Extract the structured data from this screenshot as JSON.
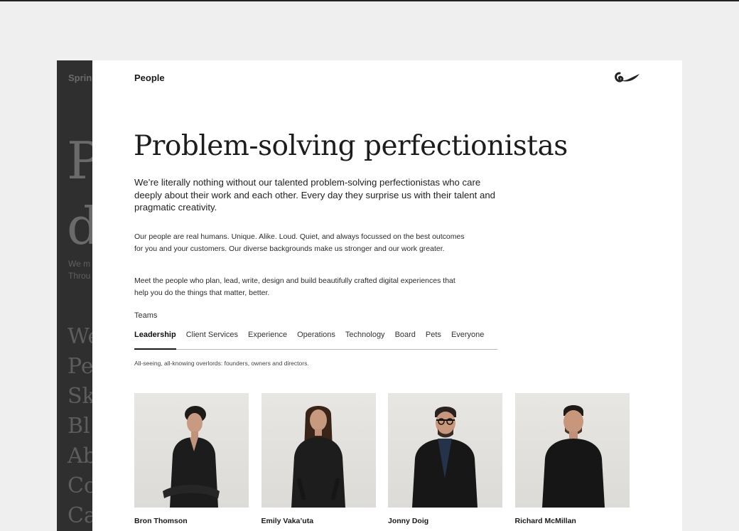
{
  "background_page": {
    "brand": "Sprin",
    "hero": [
      "P",
      "d"
    ],
    "subtext": [
      "We m",
      "Throu"
    ],
    "nav": [
      "We",
      "Pe",
      "Sk",
      "Bl",
      "Ab",
      "Co",
      "Ca"
    ]
  },
  "header": {
    "title": "People",
    "logo_icon": "brand-logo-icon"
  },
  "hero": {
    "title": "Problem-solving perfectionistas"
  },
  "intro": {
    "lead": "We’re literally nothing without our talented problem-solving perfectionistas who care deeply about their work and each other. Every day they surprise us with their talent and pragmatic creativity.",
    "paragraph_1": "Our people are real humans. Unique. Alike. Loud. Quiet, and always focussed on the best outcomes for you and your customers. Our diverse backgrounds make us stronger and our work greater.",
    "paragraph_2": "Meet the people who plan, lead, write, design and build beautifully crafted digital experiences that help you do the things that matter, better."
  },
  "teams": {
    "label": "Teams",
    "tabs": [
      "Leadership",
      "Client Services",
      "Experience",
      "Operations",
      "Technology",
      "Board",
      "Pets",
      "Everyone"
    ],
    "active": "Leadership",
    "description": "All-seeing, all-knowing overlords: founders, owners and directors."
  },
  "people": [
    {
      "name": "Bron Thomson"
    },
    {
      "name": "Emily Vaka’uta"
    },
    {
      "name": "Jonny Doig"
    },
    {
      "name": "Richard McMillan"
    }
  ],
  "colors": {
    "page_bg": "#efefef",
    "panel_dark": "#2f2f2f",
    "sheet_bg": "#ffffff",
    "text": "#1f1f1f"
  }
}
